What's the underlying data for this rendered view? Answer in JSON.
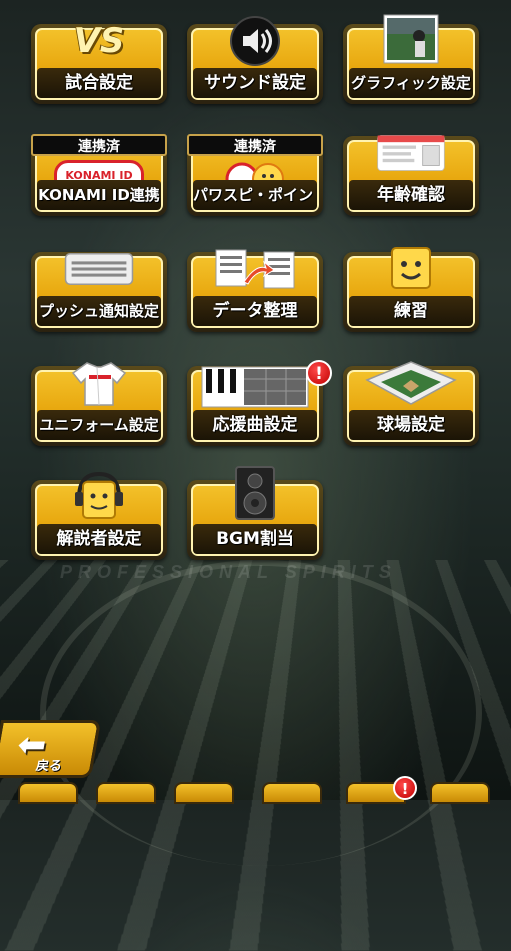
{
  "settings": {
    "match_settings": "試合設定",
    "match_icon_text": "VS",
    "sound_settings": "サウンド設定",
    "graphic_settings": "グラフィック設定",
    "konami_linked_status": "連携済",
    "konami_id_link": "KONAMI ID連携",
    "konami_logo": "KONAMI ID",
    "pawaspi_linked_status": "連携済",
    "pawaspi_point": "パワスピ・ポイント",
    "age_check": "年齢確認",
    "push_settings": "プッシュ通知設定",
    "data_organize": "データ整理",
    "practice": "練習",
    "uniform_settings": "ユニフォーム設定",
    "cheer_song_settings": "応援曲設定",
    "stadium_settings": "球場設定",
    "commentator_settings": "解説者設定",
    "bgm_assign": "BGM割当"
  },
  "alerts": {
    "cheer_song": "!",
    "tab_badge": "!"
  },
  "back_button": {
    "label": "戻る"
  },
  "colors": {
    "button_gold": "#f3c12a",
    "button_dark": "#3a2a0c",
    "alert_red": "#d00000"
  }
}
